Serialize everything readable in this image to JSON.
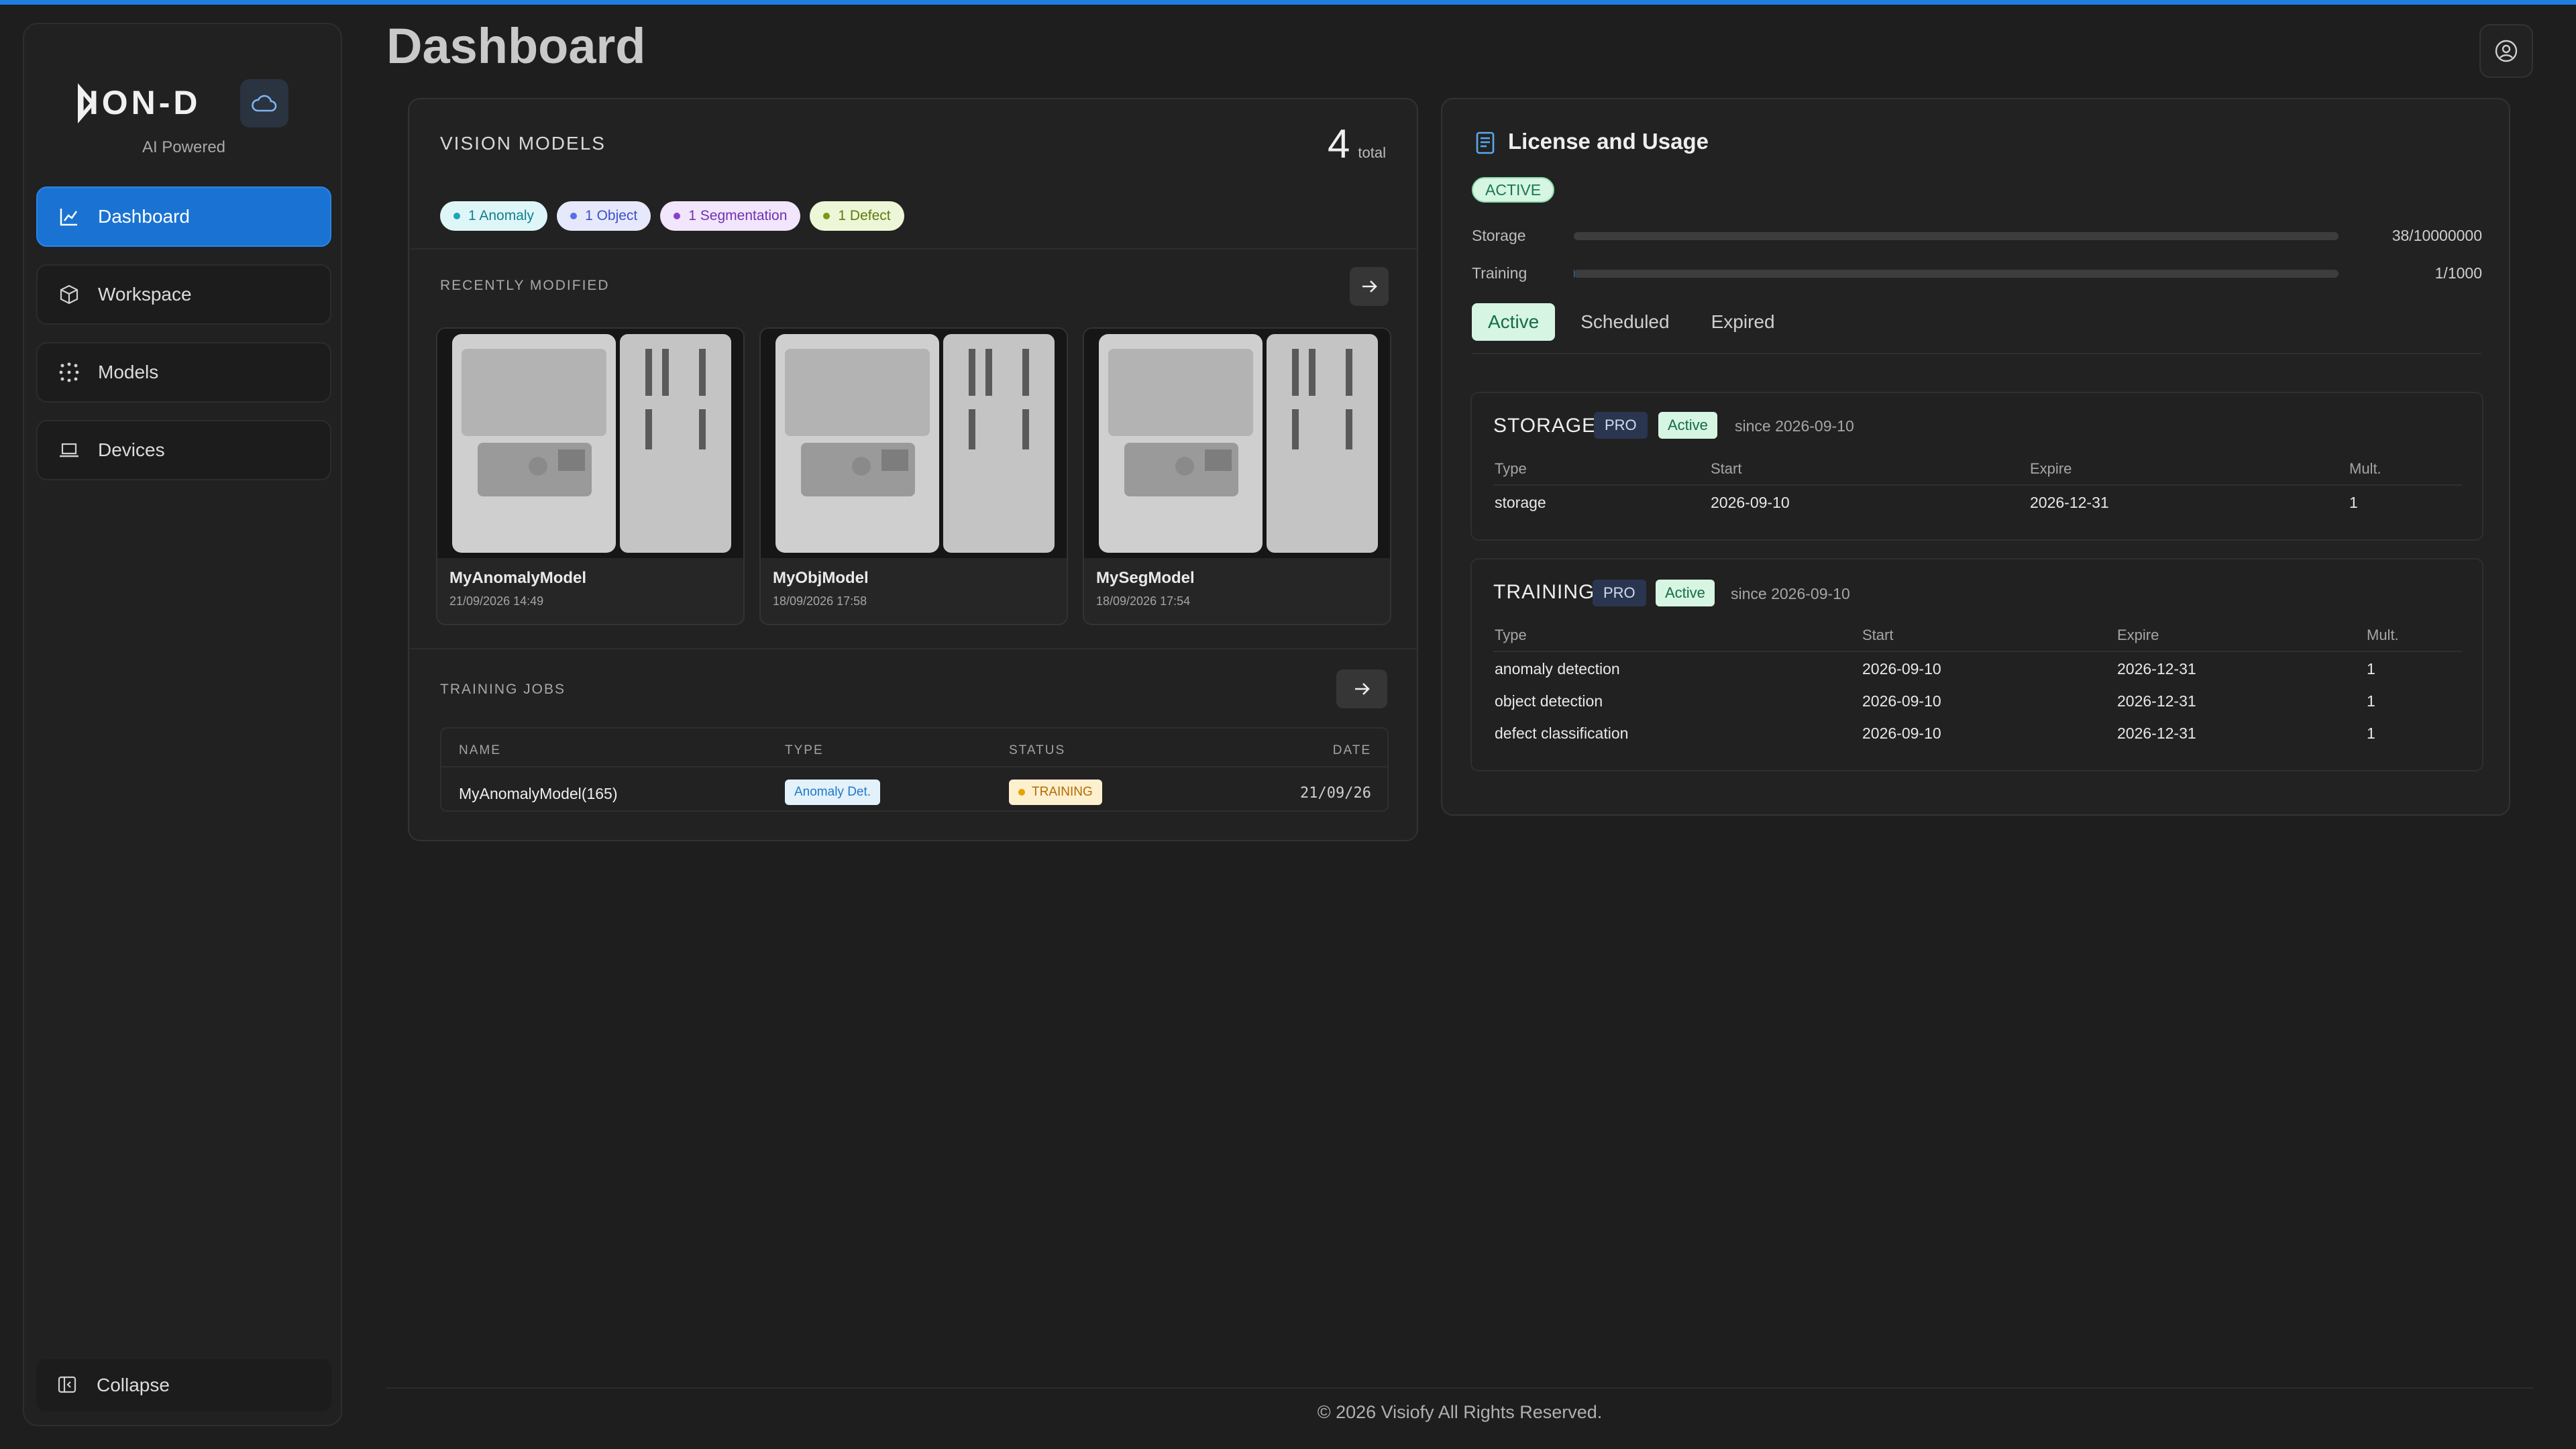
{
  "colors": {
    "accent": "#1a73d2",
    "active_bg": "#d6f5e2",
    "active_text": "#166c45"
  },
  "brand": {
    "name": "IION-D",
    "tagline": "AI Powered",
    "icon": "cloud-icon"
  },
  "sidebar": {
    "items": [
      {
        "label": "Dashboard",
        "icon": "chart-icon",
        "active": true
      },
      {
        "label": "Workspace",
        "icon": "cube-icon",
        "active": false
      },
      {
        "label": "Models",
        "icon": "dots-icon",
        "active": false
      },
      {
        "label": "Devices",
        "icon": "laptop-icon",
        "active": false
      }
    ],
    "collapse_label": "Collapse"
  },
  "header": {
    "title": "Dashboard",
    "user_icon": "user-circle-icon"
  },
  "vision_models": {
    "title": "VISION MODELS",
    "total": "4",
    "total_label": "total",
    "tags": [
      {
        "label": "1 Anomaly",
        "color": "#1aa6b7"
      },
      {
        "label": "1 Object",
        "color": "#5b6ee8"
      },
      {
        "label": "1 Segmentation",
        "color": "#8a3fd1"
      },
      {
        "label": "1 Defect",
        "color": "#7a9a12"
      }
    ],
    "recent_label": "RECENTLY MODIFIED",
    "recent": [
      {
        "name": "MyAnomalyModel",
        "date": "21/09/2026 14:49"
      },
      {
        "name": "MyObjModel",
        "date": "18/09/2026 17:58"
      },
      {
        "name": "MySegModel",
        "date": "18/09/2026 17:54"
      }
    ],
    "training_label": "TRAINING JOBS",
    "training_columns": [
      "NAME",
      "TYPE",
      "STATUS",
      "DATE"
    ],
    "training_rows": [
      {
        "name": "MyAnomalyModel(165)",
        "type": "Anomaly Det.",
        "status": "TRAINING",
        "date": "21/09/26"
      }
    ]
  },
  "license": {
    "title": "License and Usage",
    "status": "ACTIVE",
    "usage": [
      {
        "label": "Storage",
        "value": "38/10000000",
        "fraction": 3.8e-06
      },
      {
        "label": "Training",
        "value": "1/1000",
        "fraction": 0.001
      }
    ],
    "tabs": [
      "Active",
      "Scheduled",
      "Expired"
    ],
    "storage": {
      "title": "STORAGE",
      "plan": "PRO",
      "state": "Active",
      "since": "since 2026-09-10",
      "columns": [
        "Type",
        "Start",
        "Expire",
        "Mult."
      ],
      "rows": [
        {
          "type": "storage",
          "start": "2026-09-10",
          "expire": "2026-12-31",
          "mult": "1"
        }
      ]
    },
    "training": {
      "title": "TRAINING",
      "plan": "PRO",
      "state": "Active",
      "since": "since 2026-09-10",
      "columns": [
        "Type",
        "Start",
        "Expire",
        "Mult."
      ],
      "rows": [
        {
          "type": "anomaly detection",
          "start": "2026-09-10",
          "expire": "2026-12-31",
          "mult": "1"
        },
        {
          "type": "object detection",
          "start": "2026-09-10",
          "expire": "2026-12-31",
          "mult": "1"
        },
        {
          "type": "defect classification",
          "start": "2026-09-10",
          "expire": "2026-12-31",
          "mult": "1"
        }
      ]
    }
  },
  "footer": {
    "text": "© 2026 Visiofy All Rights Reserved."
  }
}
